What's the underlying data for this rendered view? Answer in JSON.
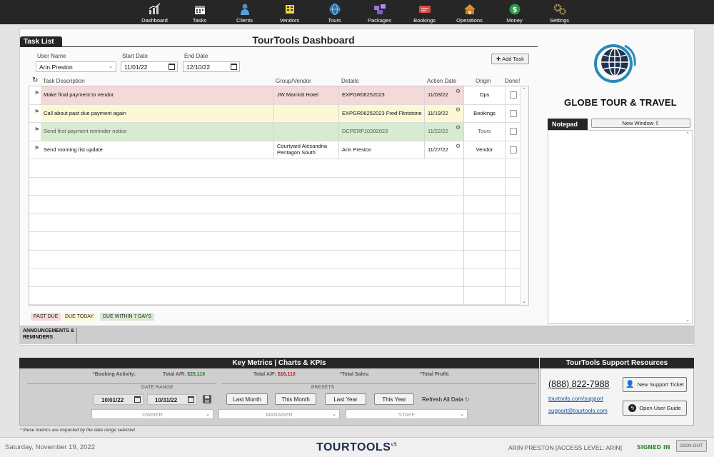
{
  "nav": [
    {
      "label": "Dashboard",
      "icon": "chart-icon"
    },
    {
      "label": "Tasks",
      "icon": "calendar-icon"
    },
    {
      "label": "Clients",
      "icon": "person-icon"
    },
    {
      "label": "Vendors",
      "icon": "vendors-icon"
    },
    {
      "label": "Tours",
      "icon": "globe-icon"
    },
    {
      "label": "Packages",
      "icon": "packages-icon"
    },
    {
      "label": "Bookings",
      "icon": "ticket-icon"
    },
    {
      "label": "Operations",
      "icon": "house-icon"
    },
    {
      "label": "Money",
      "icon": "money-icon"
    },
    {
      "label": "Settings",
      "icon": "gear-icon"
    }
  ],
  "page_title": "TourTools Dashboard",
  "tasklist": {
    "tab_label": "Task List",
    "filters": {
      "user_label": "User Name",
      "user_value": "Arin Preston",
      "start_label": "Start Date",
      "start_value": "11/01/22",
      "end_label": "End Date",
      "end_value": "12/10/22"
    },
    "add_task_label": "✚ Add Task",
    "columns": [
      "Task Description",
      "Group/Vendor",
      "Details",
      "Action Date",
      "Origin",
      "Done!"
    ],
    "rows": [
      {
        "desc": "Make final payment to vendor",
        "vendor": "JW Marriott Hotel",
        "details": "EXPGR06252023",
        "date": "11/03/22",
        "origin": "Ops",
        "status": "past"
      },
      {
        "desc": "Call about past due payment again",
        "vendor": "",
        "details": "EXPGR06252023 Fred Flintstone",
        "date": "11/19/22",
        "origin": "Bookings",
        "status": "today"
      },
      {
        "desc": "Send first payment reminder notice",
        "vendor": "",
        "details": "DCPERF10282023",
        "date": "11/22/22",
        "origin": "Tours",
        "status": "week"
      },
      {
        "desc": "Send rooming list update",
        "vendor": "Courtyard Alexandria Pentagon South",
        "details": "Arin Preston",
        "date": "11/27/22",
        "origin": "Vendor",
        "status": "none"
      }
    ],
    "legend": {
      "past": "PAST DUE",
      "today": "DUE TODAY",
      "week": "DUE WITHIN 7 DAYS"
    }
  },
  "colors": {
    "past": "#f4d9d9",
    "today": "#fcf8d6",
    "week": "#d6ebd0",
    "accent": "#262626"
  },
  "announcements_label": "ANNOUNCEMENTS & REMINDERS",
  "brand_name": "GLOBE TOUR & TRAVEL",
  "notepad": {
    "tab_label": "Notepad",
    "new_window_label": "New Window ⇧"
  },
  "metrics": {
    "title": "Key Metrics | Charts & KPIs",
    "booking_activity": "*Booking Activity:",
    "ar_label": "Total A/R:",
    "ar_value": "$25,116",
    "ap_label": "Total A/P:",
    "ap_value": "$16,110",
    "sales_label": "*Total Sales:",
    "profit_label": "*Total Profit:",
    "date_range_label": "DATE RANGE",
    "presets_label": "PRESETS",
    "from_date": "10/01/22",
    "to_date": "10/31/22",
    "presets": [
      "Last Month",
      "This Month",
      "Last Year",
      "This Year"
    ],
    "refresh_label": "Refresh All Data",
    "owner": "OWNER",
    "manager": "MANAGER",
    "staff": "STAFF"
  },
  "support": {
    "title": "TourTools Support Resources",
    "phone": "(888) 822-7988",
    "site": "tourtools.com/support",
    "email": "support@tourtools.com",
    "ticket_label": "New Support Ticket",
    "guide_label": "Open User Guide"
  },
  "footnote": "* these metrics are impacted by the date range selected",
  "footer": {
    "date": "Saturday, November 19, 2022",
    "logo": "TOURTOOLS",
    "version": "v5",
    "user": "ARIN PRESTON [ACCESS LEVEL: ARIN]",
    "signed": "SIGNED IN",
    "signout": "SIGN OUT"
  }
}
